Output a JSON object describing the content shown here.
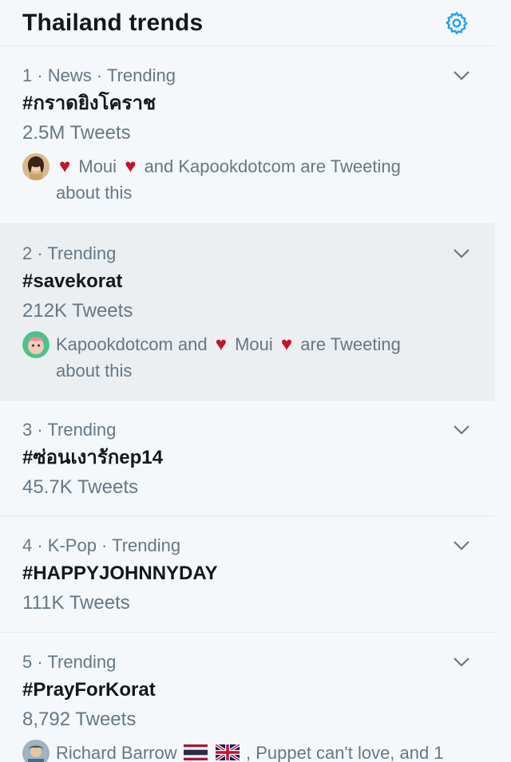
{
  "header": {
    "title": "Thailand trends",
    "settings_icon": "gear-icon",
    "accent": "#1da1f2"
  },
  "trends": [
    {
      "meta": "1 · News · Trending",
      "name": "#กราดยิงโคราช",
      "count": "2.5M Tweets",
      "social": {
        "parts": [
          "Moui",
          "and Kapookdotcom are Tweeting",
          "about this"
        ]
      }
    },
    {
      "meta": "2 · Trending",
      "name": "#savekorat",
      "count": "212K Tweets",
      "social": {
        "parts": [
          "Kapookdotcom and",
          "Moui",
          "are Tweeting",
          "about this"
        ]
      }
    },
    {
      "meta": "3 · Trending",
      "name": "#ซ่อนเงารักep14",
      "count": "45.7K Tweets"
    },
    {
      "meta": "4 · K-Pop · Trending",
      "name": "#HAPPYJOHNNYDAY",
      "count": "111K Tweets"
    },
    {
      "meta": "5 · Trending",
      "name": "#PrayForKorat",
      "count": "8,792 Tweets",
      "social": {
        "parts": [
          "Richard Barrow",
          ", Puppet can't love, and 1"
        ]
      }
    }
  ],
  "colors": {
    "heart": "#c5132c",
    "muted": "#657786",
    "text": "#14171a",
    "hover_bg": "#eceff1"
  }
}
